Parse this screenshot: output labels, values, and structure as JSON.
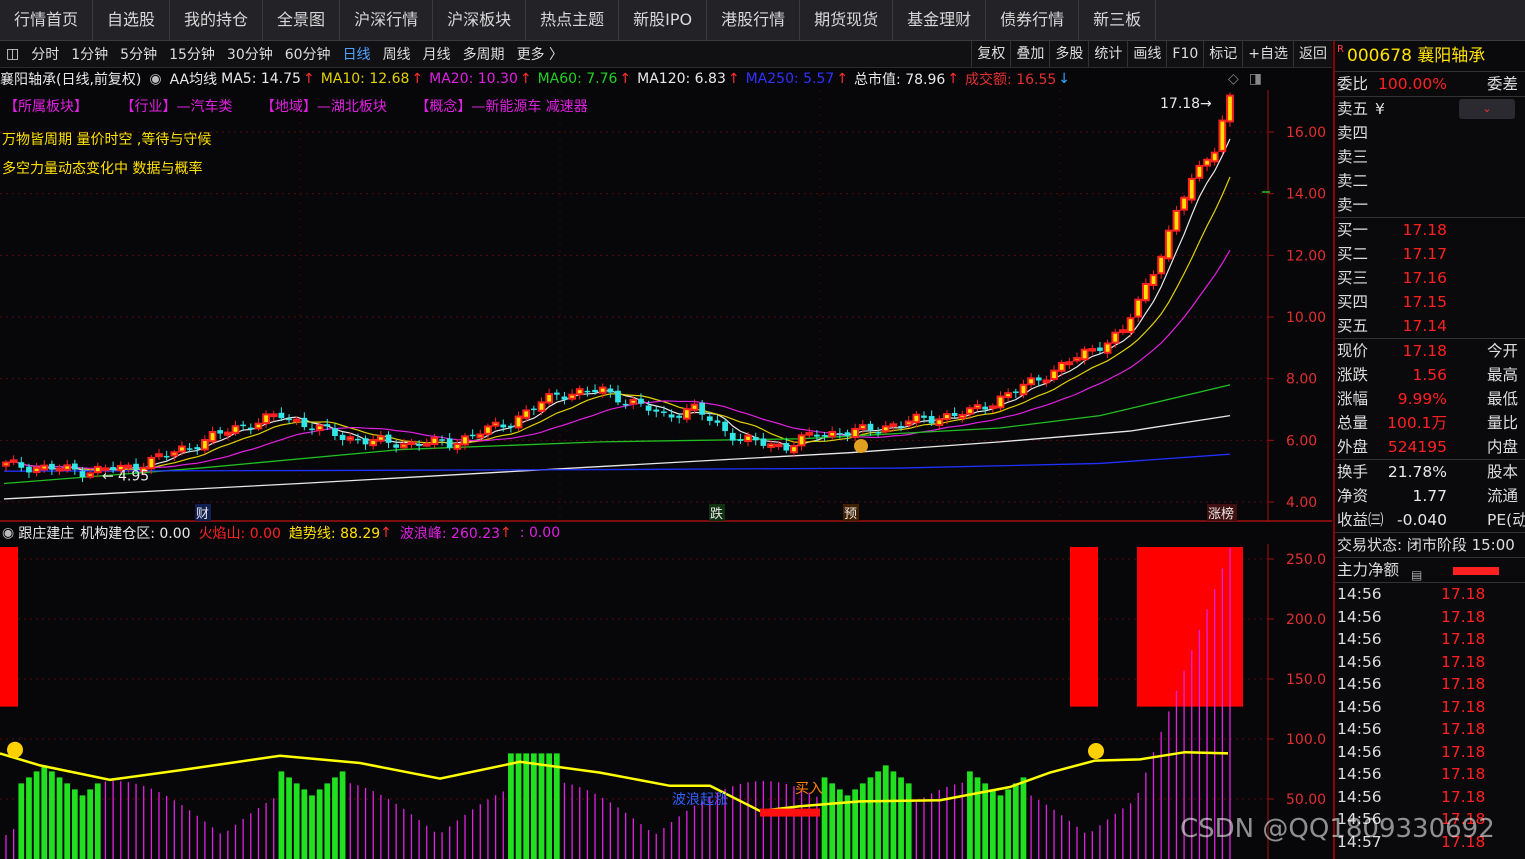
{
  "nav": [
    "行情首页",
    "自选股",
    "我的持仓",
    "全景图",
    "沪深行情",
    "沪深板块",
    "热点主题",
    "新股IPO",
    "港股行情",
    "期货现货",
    "基金理财",
    "债券行情",
    "新三板"
  ],
  "timeframes": [
    "分时",
    "1分钟",
    "5分钟",
    "15分钟",
    "30分钟",
    "60分钟",
    "日线",
    "周线",
    "月线",
    "多周期",
    "更多 〉"
  ],
  "active_timeframe": "日线",
  "tools": [
    "复权",
    "叠加",
    "多股",
    "统计",
    "画线",
    "F10",
    "标记",
    "+自选",
    "返回"
  ],
  "stock_header": {
    "code": "000678",
    "name": "襄阳轴承",
    "badge": "R"
  },
  "ma_row": {
    "title": "襄阳轴承(日线,前复权)",
    "ma_name": "AA均线",
    "ma5": "MA5: 14.75",
    "ma10": "MA10: 12.68",
    "ma20": "MA20: 10.30",
    "ma60": "MA60: 7.76",
    "ma120": "MA120: 6.83",
    "ma250": "MA250: 5.57",
    "cap": "总市值: 78.96",
    "amount": "成交额: 16.55"
  },
  "tags": {
    "sector": "【所属板块】",
    "industry": "【行业】—汽车类",
    "region": "【地域】—湖北板块",
    "concept": "【概念】—新能源车 减速器"
  },
  "slogans": [
    "万物皆周期   量价时空   ,等待与守候",
    "多空力量动态变化中  数据与概率"
  ],
  "price_axis": [
    "16.00",
    "14.00",
    "12.00",
    "10.00",
    "8.00",
    "6.00",
    "4.00"
  ],
  "price_marks": {
    "high": "17.18",
    "low": "4.95"
  },
  "event_marks": [
    "财",
    "跌",
    "预",
    "涨榜"
  ],
  "ind_row": {
    "name": "跟庄建庄",
    "base": "机构建仓区: 0.00",
    "fire": "火焰山: 0.00",
    "trend": "趋势线: 88.29",
    "wave": "波浪峰: 260.23",
    "extra": ": 0.00"
  },
  "ind_axis": [
    "250.0",
    "200.0",
    "150.0",
    "100.0",
    "50.00"
  ],
  "ind_texts": {
    "wave_label": "波浪起涨",
    "buy": "买入"
  },
  "right_panel": {
    "weibi": {
      "label": "委比",
      "value": "100.00%",
      "extra": "委差"
    },
    "sells": [
      {
        "label": "卖五",
        "value": "¥"
      },
      {
        "label": "卖四",
        "value": ""
      },
      {
        "label": "卖三",
        "value": ""
      },
      {
        "label": "卖二",
        "value": ""
      },
      {
        "label": "卖一",
        "value": ""
      }
    ],
    "buys": [
      {
        "label": "买一",
        "value": "17.18"
      },
      {
        "label": "买二",
        "value": "17.17"
      },
      {
        "label": "买三",
        "value": "17.16"
      },
      {
        "label": "买四",
        "value": "17.15"
      },
      {
        "label": "买五",
        "value": "17.14"
      }
    ],
    "stats": [
      {
        "label": "现价",
        "value": "17.18",
        "extra": "今开"
      },
      {
        "label": "涨跌",
        "value": "1.56",
        "extra": "最高"
      },
      {
        "label": "涨幅",
        "value": "9.99%",
        "extra": "最低"
      },
      {
        "label": "总量",
        "value": "100.1万",
        "extra": "量比"
      },
      {
        "label": "外盘",
        "value": "524195",
        "extra": "内盘"
      }
    ],
    "stats2": [
      {
        "label": "换手",
        "value": "21.78%",
        "extra": "股本"
      },
      {
        "label": "净资",
        "value": "1.77",
        "extra": "流通"
      },
      {
        "label": "收益㈢",
        "value": "-0.040",
        "extra": "PE(动"
      }
    ],
    "trade_state": "交易状态: 闭市阶段 15:00",
    "main_net": "主力净额",
    "ticks": [
      {
        "t": "14:56",
        "p": "17.18"
      },
      {
        "t": "14:56",
        "p": "17.18"
      },
      {
        "t": "14:56",
        "p": "17.18"
      },
      {
        "t": "14:56",
        "p": "17.18"
      },
      {
        "t": "14:56",
        "p": "17.18"
      },
      {
        "t": "14:56",
        "p": "17.18"
      },
      {
        "t": "14:56",
        "p": "17.18"
      },
      {
        "t": "14:56",
        "p": "17.18"
      },
      {
        "t": "14:56",
        "p": "17.18"
      },
      {
        "t": "14:56",
        "p": "17.18"
      },
      {
        "t": "14:56",
        "p": "17.18"
      },
      {
        "t": "14:57",
        "p": "17.18"
      }
    ]
  },
  "watermark": "CSDN @QQ1809330692",
  "colors": {
    "up": "#ff2020",
    "down": "#32e6e6",
    "yellow": "#ffff00",
    "magenta": "#e020e0",
    "green": "#20c020",
    "white": "#e8e8e8",
    "blue": "#2020ff"
  }
}
